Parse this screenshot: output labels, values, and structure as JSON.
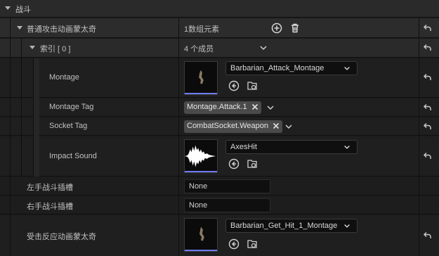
{
  "section": {
    "title": "战斗"
  },
  "array": {
    "label": "普通攻击动画蒙太奇",
    "summary": "1数组元素"
  },
  "index": {
    "label": "索引 [ 0 ]",
    "summary": "4 个成员"
  },
  "montage": {
    "label": "Montage",
    "asset": "Barbarian_Attack_Montage"
  },
  "montage_tag": {
    "label": "Montage Tag",
    "value": "Montage.Attack.1"
  },
  "socket_tag": {
    "label": "Socket Tag",
    "value": "CombatSocket.Weapon"
  },
  "impact_sound": {
    "label": "Impact Sound",
    "asset": "AxesHit"
  },
  "left_socket": {
    "label": "左手战斗插槽",
    "value": "None"
  },
  "right_socket": {
    "label": "右手战斗插槽",
    "value": "None"
  },
  "hit_react": {
    "label": "受击反应动画蒙太奇",
    "asset": "Barbarian_Get_Hit_1_Montage"
  },
  "colors": {
    "accent": "#6e7bff",
    "header_bg": "#2f2f2f",
    "row_bg": "#1a1a1a"
  },
  "icons": [
    "chevron-down-icon",
    "add-icon",
    "trash-icon",
    "reset-arrow-icon",
    "browse-arrow-icon",
    "find-in-folder-icon",
    "close-icon"
  ]
}
